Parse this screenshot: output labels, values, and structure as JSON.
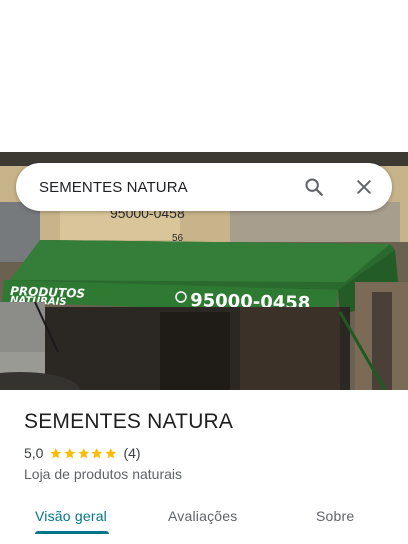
{
  "search": {
    "query": "SEMENTES NATURA"
  },
  "photo": {
    "awning_left_text": "PRODUTOS NATURAIS",
    "awning_phone": "95000-0458",
    "wall_phone": "95000-0458",
    "awning_color": "#2f7a35"
  },
  "place": {
    "name": "SEMENTES NATURA",
    "rating": "5,0",
    "stars": 5,
    "review_count": "(4)",
    "category": "Loja de produtos naturais"
  },
  "tabs": [
    {
      "label": "Visão geral",
      "active": true
    },
    {
      "label": "Avaliações",
      "active": false
    },
    {
      "label": "Sobre",
      "active": false
    }
  ],
  "colors": {
    "accent": "#00758a",
    "star": "#fbbc04"
  }
}
